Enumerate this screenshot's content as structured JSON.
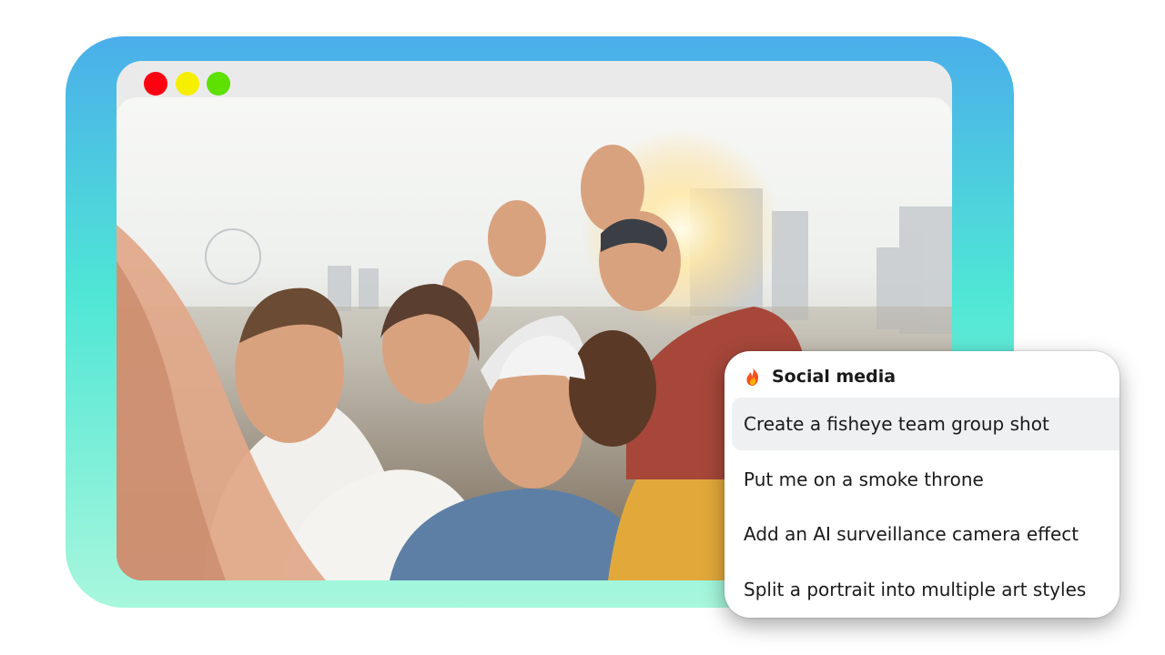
{
  "window": {
    "controls": [
      "close",
      "minimize",
      "maximize"
    ]
  },
  "photo": {
    "description_icon": "group-selfie-photo"
  },
  "menu": {
    "icon": "fire-icon",
    "title": "Social media",
    "items": [
      {
        "label": "Create a fisheye team group shot",
        "highlighted": true
      },
      {
        "label": "Put me on a smoke throne",
        "highlighted": false
      },
      {
        "label": "Add an AI surveillance camera effect",
        "highlighted": false
      },
      {
        "label": "Split a portrait into multiple art styles",
        "highlighted": false
      }
    ]
  },
  "colors": {
    "frame_top": "#4aaeea",
    "frame_mid": "#4fe6d5",
    "frame_bottom": "#a8f7dc",
    "close": "#ff0010",
    "minimize": "#f6ef00",
    "maximize": "#5ee000"
  }
}
